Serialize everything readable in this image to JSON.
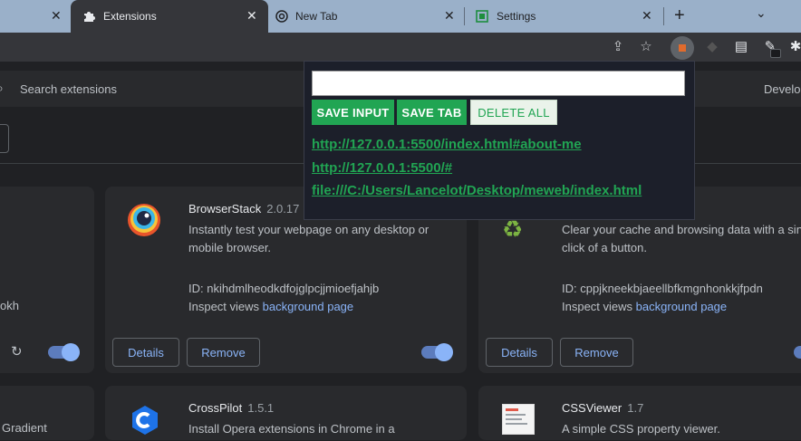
{
  "tabs": [
    {
      "title": "Extensions",
      "active": true,
      "icon": "puzzle-icon"
    },
    {
      "title": "New Tab",
      "active": false,
      "icon": "chrome-icon"
    },
    {
      "title": "Settings",
      "active": false,
      "icon": "settings-icon"
    }
  ],
  "search": {
    "placeholder": "Search extensions"
  },
  "header_right": "Develop",
  "popup": {
    "input_value": "",
    "save_input_label": "SAVE INPUT",
    "save_tab_label": "SAVE TAB",
    "delete_all_label": "DELETE ALL",
    "links": [
      "http://127.0.0.1:5500/index.html#about-me",
      "http://127.0.0.1:5500/#",
      "file:///C:/Users/Lancelot/Desktop/meweb/index.html"
    ]
  },
  "cards": {
    "left_partial": {
      "id_tail": "okh"
    },
    "browserstack": {
      "name": "BrowserStack",
      "version": "2.0.17",
      "desc_line1": "Instantly test your webpage on any desktop or",
      "desc_line2": "mobile browser.",
      "id": "ID: nkihdmlheodkdfojglpcjjmioefjahjb",
      "inspect_prefix": "Inspect views",
      "inspect_link": "background page",
      "details_label": "Details",
      "remove_label": "Remove",
      "enabled": true
    },
    "cleaner": {
      "desc_line1": "Clear your cache and browsing data with a sin",
      "desc_line2": "click of a button.",
      "id": "ID: cppjkneekbjaeellbfkmgnhonkkjfpdn",
      "inspect_prefix": "Inspect views",
      "inspect_link": "background page",
      "details_label": "Details",
      "remove_label": "Remove"
    },
    "bottom_left_partial": {
      "text": "Gradient"
    },
    "crosspilot": {
      "name": "CrossPilot",
      "version": "1.5.1",
      "desc": "Install Opera extensions in Chrome in a"
    },
    "cssviewer": {
      "name": "CSSViewer",
      "version": "1.7",
      "desc": "A simple CSS property viewer."
    }
  },
  "colors": {
    "accent_green": "#21a553",
    "link_blue": "#8ab4f8",
    "tabstrip": "#9ab0c9"
  }
}
